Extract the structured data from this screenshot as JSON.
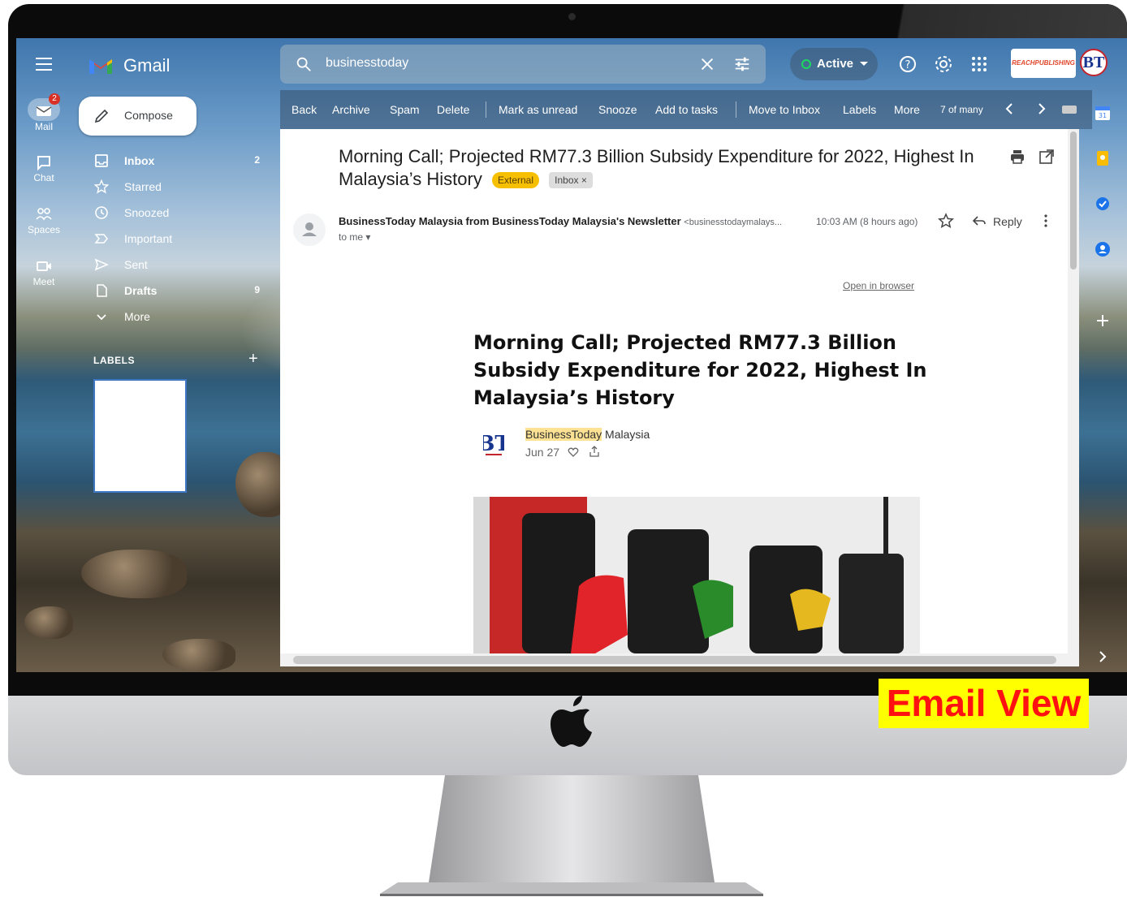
{
  "overlay_label": "Email View",
  "app": {
    "name": "Gmail",
    "brand_box_text": "REACHPUBLISHING",
    "avatar_text": "BT"
  },
  "search": {
    "value": "businesstoday"
  },
  "status": {
    "label": "Active",
    "color": "#1ed760"
  },
  "rail": {
    "mail_badge": "2",
    "items": [
      {
        "label": "Mail",
        "icon": "mail-icon"
      },
      {
        "label": "Chat",
        "icon": "chat-icon"
      },
      {
        "label": "Spaces",
        "icon": "spaces-icon"
      },
      {
        "label": "Meet",
        "icon": "meet-icon"
      }
    ]
  },
  "sidebar": {
    "compose_label": "Compose",
    "items": [
      {
        "label": "Inbox",
        "count": "2",
        "icon": "inbox-icon"
      },
      {
        "label": "Starred",
        "count": "",
        "icon": "star-icon"
      },
      {
        "label": "Snoozed",
        "count": "",
        "icon": "clock-icon"
      },
      {
        "label": "Important",
        "count": "",
        "icon": "important-icon"
      },
      {
        "label": "Sent",
        "count": "",
        "icon": "send-icon"
      },
      {
        "label": "Drafts",
        "count": "9",
        "icon": "file-icon"
      },
      {
        "label": "More",
        "count": "",
        "icon": "chevron-down-icon"
      }
    ],
    "labels_heading": "LABELS"
  },
  "toolbar": {
    "back": "Back",
    "archive": "Archive",
    "spam": "Spam",
    "delete": "Delete",
    "mark_unread": "Mark as unread",
    "snooze": "Snooze",
    "add_tasks": "Add to tasks",
    "move_inbox": "Move to Inbox",
    "labels": "Labels",
    "more": "More",
    "count": "7 of many"
  },
  "email": {
    "subject": "Morning Call; Projected RM77.3 Billion Subsidy Expenditure for 2022, Highest In Malaysia’s History",
    "chip_external": "External",
    "chip_inbox": "Inbox ×",
    "sender_name": "BusinessToday Malaysia from BusinessToday Malaysia's Newsletter",
    "sender_addr": "<businesstodaymalays...",
    "time": "10:03 AM (8 hours ago)",
    "reply_label": "Reply",
    "to": "to me",
    "open_browser": "Open in browser",
    "article_title": "Morning Call; Projected RM77.3 Billion Subsidy Expenditure for 2022, Highest In Malaysia’s History",
    "publisher_highlight": "BusinessToday",
    "publisher_rest": " Malaysia",
    "date": "Jun 27"
  }
}
